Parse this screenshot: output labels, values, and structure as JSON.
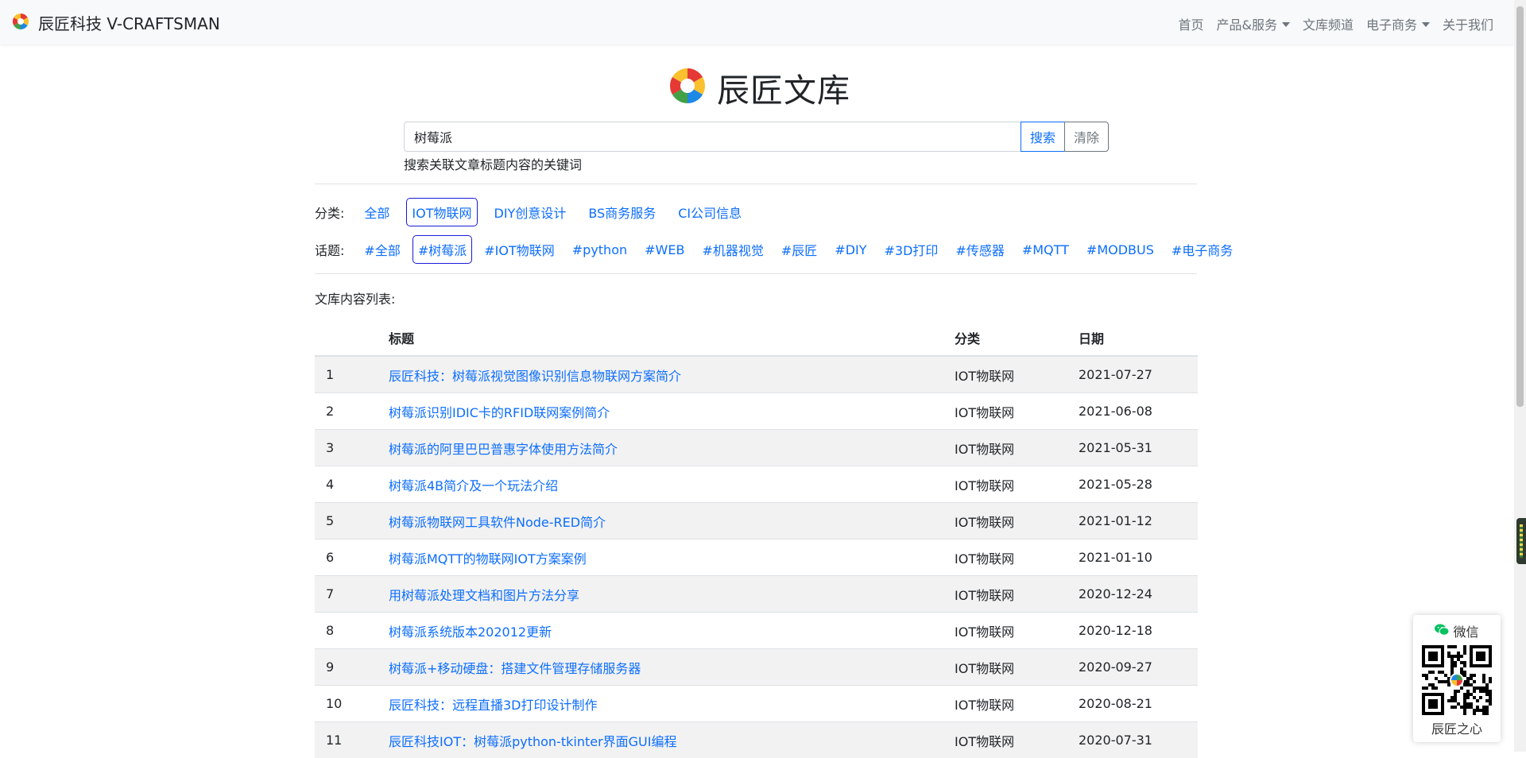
{
  "brand": {
    "title": "辰匠科技 V-CRAFTSMAN"
  },
  "nav": {
    "items": [
      {
        "label": "首页"
      },
      {
        "label": "产品&服务"
      },
      {
        "label": "文库频道"
      },
      {
        "label": "电子商务"
      },
      {
        "label": "关于我们"
      }
    ]
  },
  "site": {
    "name": "辰匠文库"
  },
  "search": {
    "value": "树莓派",
    "search_label": "搜索",
    "clear_label": "清除",
    "help": "搜索关联文章标题内容的关键词"
  },
  "filters": {
    "category_label": "分类:",
    "categories": [
      "全部",
      "IOT物联网",
      "DIY创意设计",
      "BS商务服务",
      "CI公司信息"
    ],
    "category_active": "IOT物联网",
    "topic_label": "话题:",
    "topics": [
      "#全部",
      "#树莓派",
      "#IOT物联网",
      "#python",
      "#WEB",
      "#机器视觉",
      "#辰匠",
      "#DIY",
      "#3D打印",
      "#传感器",
      "#MQTT",
      "#MODBUS",
      "#电子商务"
    ],
    "topic_active": "#树莓派"
  },
  "list": {
    "title": "文库内容列表:",
    "headers": {
      "index": "",
      "title": "标题",
      "category": "分类",
      "date": "日期"
    },
    "rows": [
      {
        "index": "1",
        "title": "辰匠科技：树莓派视觉图像识别信息物联网方案简介",
        "category": "IOT物联网",
        "date": "2021-07-27"
      },
      {
        "index": "2",
        "title": "树莓派识别IDIC卡的RFID联网案例简介",
        "category": "IOT物联网",
        "date": "2021-06-08"
      },
      {
        "index": "3",
        "title": "树莓派的阿里巴巴普惠字体使用方法简介",
        "category": "IOT物联网",
        "date": "2021-05-31"
      },
      {
        "index": "4",
        "title": "树莓派4B简介及一个玩法介绍",
        "category": "IOT物联网",
        "date": "2021-05-28"
      },
      {
        "index": "5",
        "title": "树莓派物联网工具软件Node-RED简介",
        "category": "IOT物联网",
        "date": "2021-01-12"
      },
      {
        "index": "6",
        "title": "树莓派MQTT的物联网IOT方案案例",
        "category": "IOT物联网",
        "date": "2021-01-10"
      },
      {
        "index": "7",
        "title": "用树莓派处理文档和图片方法分享",
        "category": "IOT物联网",
        "date": "2020-12-24"
      },
      {
        "index": "8",
        "title": "树莓派系统版本202012更新",
        "category": "IOT物联网",
        "date": "2020-12-18"
      },
      {
        "index": "9",
        "title": "树莓派+移动硬盘：搭建文件管理存储服务器",
        "category": "IOT物联网",
        "date": "2020-09-27"
      },
      {
        "index": "10",
        "title": "辰匠科技：远程直播3D打印设计制作",
        "category": "IOT物联网",
        "date": "2020-08-21"
      },
      {
        "index": "11",
        "title": "辰匠科技IOT：树莓派python-tkinter界面GUI编程",
        "category": "IOT物联网",
        "date": "2020-07-31"
      }
    ]
  },
  "wechat": {
    "title": "微信",
    "caption": "辰匠之心"
  },
  "icons": {
    "logo": "pinwheel-logo-icon",
    "wechat": "wechat-icon",
    "qr": "qr-code-icon"
  }
}
